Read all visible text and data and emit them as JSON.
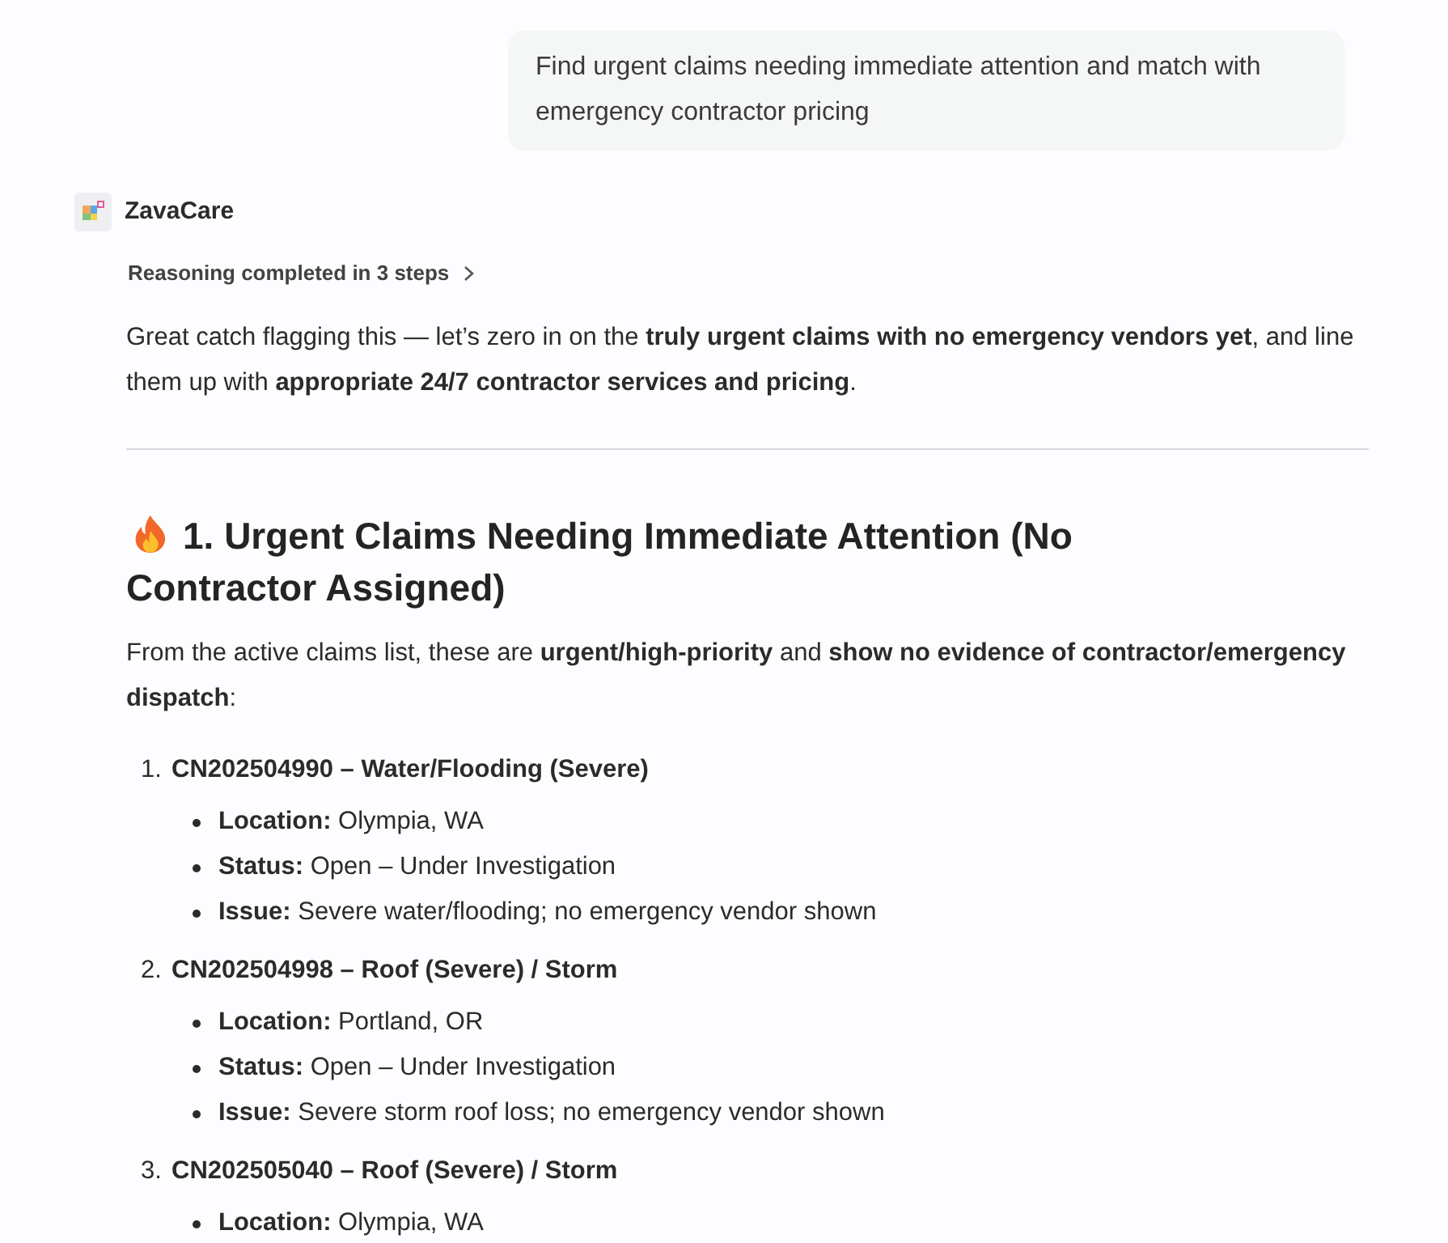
{
  "user_message": {
    "text": "Find urgent claims needing immediate attention and match with emergency contractor pricing"
  },
  "assistant": {
    "name": "ZavaCare",
    "reasoning": {
      "label": "Reasoning completed in 3 steps",
      "expanded": false
    },
    "intro": "Great catch flagging this — let’s zero in on the **truly urgent claims with no emergency vendors yet**, and line them up with **appropriate 24/7 contractor services and pricing**.",
    "sections": [
      {
        "heading": "1. Urgent Claims Needing Immediate Attention (No Contractor Assigned)",
        "lead": "From the active claims list, these are **urgent/high-priority** and **show no evidence of contractor/emergency dispatch**:",
        "claims": [
          {
            "number": "1.",
            "title": "CN202504990 – Water/Flooding (Severe)",
            "details": [
              "**Location:** Olympia, WA",
              "**Status:** Open – Under Investigation",
              "**Issue:** Severe water/flooding; no emergency vendor shown"
            ]
          },
          {
            "number": "2.",
            "title": "CN202504998 – Roof (Severe) / Storm",
            "details": [
              "**Location:** Portland, OR",
              "**Status:** Open – Under Investigation",
              "**Issue:** Severe storm roof loss; no emergency vendor shown"
            ]
          },
          {
            "number": "3.",
            "title": "CN202505040 – Roof (Severe) / Storm",
            "details": [
              "**Location:** Olympia, WA"
            ]
          }
        ]
      }
    ]
  }
}
